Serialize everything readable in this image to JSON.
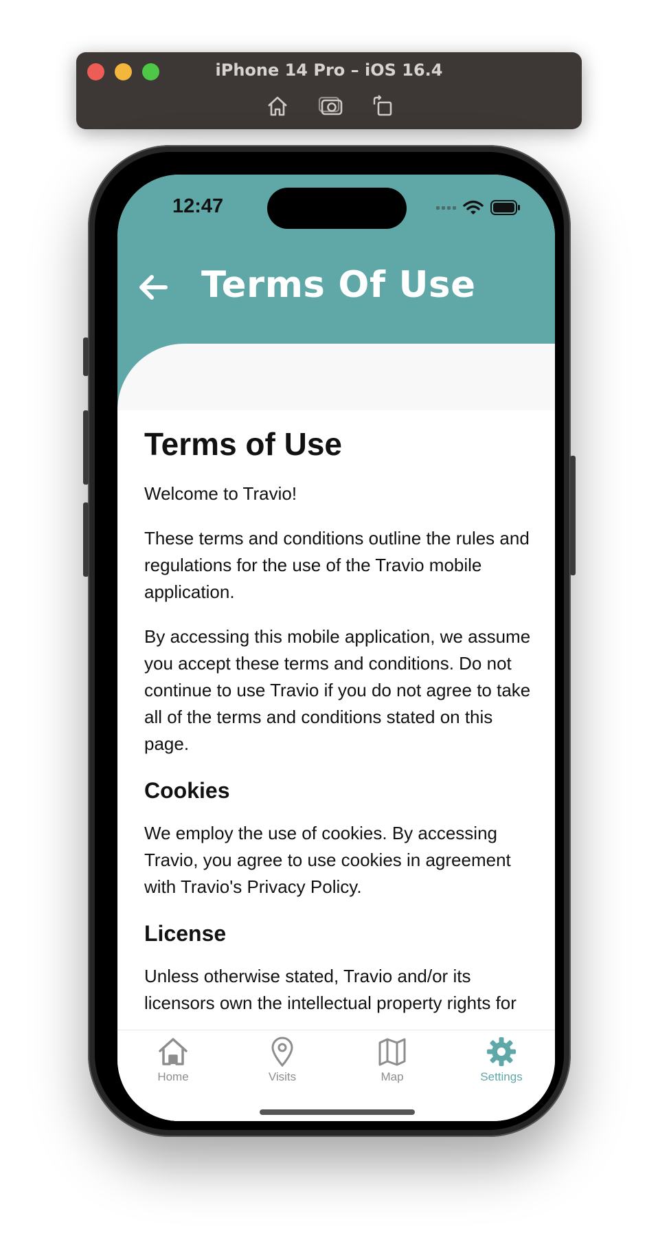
{
  "simulator": {
    "title": "iPhone 14 Pro – iOS 16.4",
    "buttons": [
      "home-icon",
      "screenshot-icon",
      "rotate-icon"
    ]
  },
  "status_bar": {
    "time": "12:47"
  },
  "header": {
    "title": "Terms Of Use",
    "back_icon": "arrow-left-icon",
    "color": "#5fa8a7"
  },
  "content": {
    "heading": "Terms of Use",
    "welcome": "Welcome to Travio!",
    "para1": "These terms and conditions outline the rules and regulations for the use of the Travio mobile application.",
    "para2": "By accessing this mobile application, we assume you accept these terms and conditions. Do not continue to use Travio if you do not agree to take all of the terms and conditions stated on this page.",
    "cookies_heading": "Cookies",
    "cookies_text": "We employ the use of cookies. By accessing Travio, you agree to use cookies in agreement with Travio's Privacy Policy.",
    "license_heading": "License",
    "license_text": "Unless otherwise stated, Travio and/or its licensors own the intellectual property rights for all material on Travio. All intellectual property rights are reserved."
  },
  "tabbar": {
    "active_color": "#5fa8a7",
    "inactive_color": "#8d8d8d",
    "items": [
      {
        "label": "Home",
        "icon": "home-icon"
      },
      {
        "label": "Visits",
        "icon": "location-pin-icon"
      },
      {
        "label": "Map",
        "icon": "map-icon"
      },
      {
        "label": "Settings",
        "icon": "gear-icon",
        "active": true
      }
    ]
  }
}
